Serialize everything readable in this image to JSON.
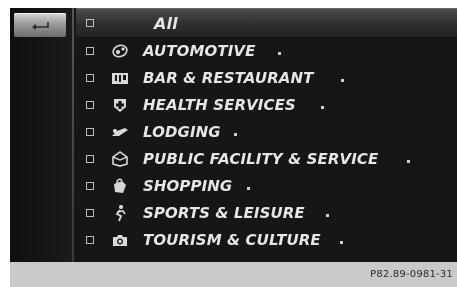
{
  "back_button": {
    "icon": "back-arrow-icon"
  },
  "categories": [
    {
      "label": "All",
      "icon": "",
      "selected": true
    },
    {
      "label": "AUTOMOTIVE",
      "icon": "car-icon",
      "has_submenu": true
    },
    {
      "label": "BAR & RESTAURANT",
      "icon": "restaurant-icon",
      "has_submenu": true
    },
    {
      "label": "HEALTH SERVICES",
      "icon": "health-cross-icon",
      "has_submenu": true
    },
    {
      "label": "LODGING",
      "icon": "bed-icon",
      "has_submenu": true
    },
    {
      "label": "PUBLIC FACILITY & SERVICE",
      "icon": "public-building-icon",
      "has_submenu": true
    },
    {
      "label": "SHOPPING",
      "icon": "shopping-bag-icon",
      "has_submenu": true
    },
    {
      "label": "SPORTS & LEISURE",
      "icon": "sports-icon",
      "has_submenu": true
    },
    {
      "label": "TOURISM & CULTURE",
      "icon": "camera-icon",
      "has_submenu": true
    }
  ],
  "footer": {
    "reference_code": "P82.89-0981-31"
  },
  "colors": {
    "screen_background": "#161616",
    "text": "#e6e6e6",
    "footer_background": "#c9c9c9"
  }
}
